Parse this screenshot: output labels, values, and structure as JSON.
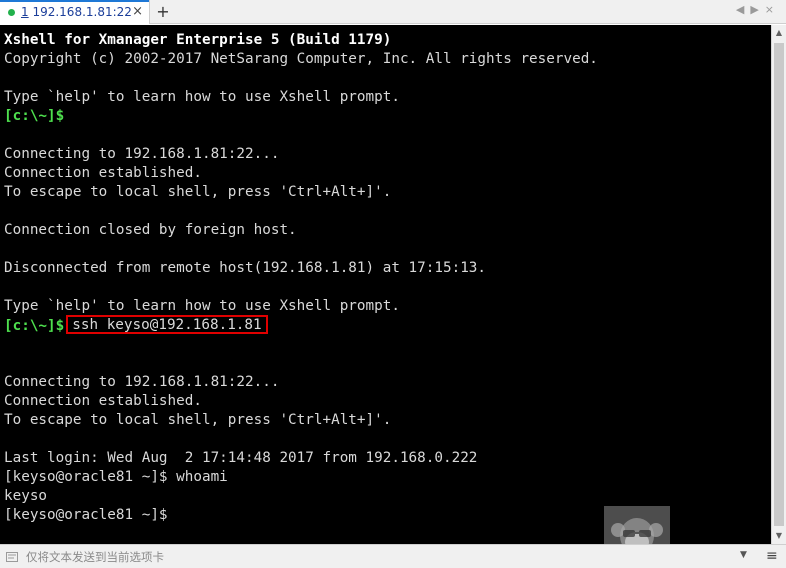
{
  "tab": {
    "number": "1",
    "title": " 192.168.1.81:22",
    "close_glyph": "×",
    "new_tab_glyph": "+",
    "nav_prev": "◀",
    "nav_next": "▶",
    "close_all": "×"
  },
  "terminal": {
    "header_line1": "Xshell for Xmanager Enterprise 5 (Build 1179)",
    "header_line2": "Copyright (c) 2002-2017 NetSarang Computer, Inc. All rights reserved.",
    "help_line_1": "Type `help' to learn how to use Xshell prompt.",
    "prompt_1": "[c:\\~]$",
    "connecting_1": "Connecting to 192.168.1.81:22...",
    "established_1": "Connection established.",
    "escape_1": "To escape to local shell, press 'Ctrl+Alt+]'.",
    "closed": "Connection closed by foreign host.",
    "disconnected": "Disconnected from remote host(192.168.1.81) at 17:15:13.",
    "help_line_2": "Type `help' to learn how to use Xshell prompt.",
    "prompt_2": "[c:\\~]$",
    "ssh_command": "ssh keyso@192.168.1.81",
    "connecting_2": "Connecting to 192.168.1.81:22...",
    "established_2": "Connection established.",
    "escape_2": "To escape to local shell, press 'Ctrl+Alt+]'.",
    "last_login": "Last login: Wed Aug  2 17:14:48 2017 from 192.168.0.222",
    "remote_prompt_1": "[keyso@oracle81 ~]$ whoami",
    "whoami_output": "keyso",
    "remote_prompt_2": "[keyso@oracle81 ~]$"
  },
  "statusbar": {
    "send_placeholder": "仅将文本发送到当前选项卡",
    "dropdown_glyph": "▼",
    "menu_glyph": "≡"
  },
  "colors": {
    "terminal_bg": "#000000",
    "text": "#d9d9d9",
    "prompt": "#4ee04e",
    "highlight_box": "#e00000",
    "tab_accent": "#1e78d6"
  }
}
